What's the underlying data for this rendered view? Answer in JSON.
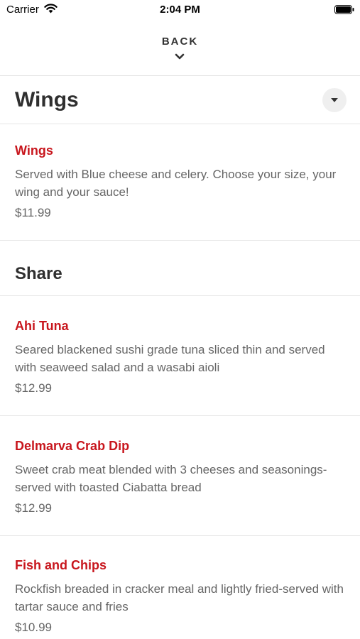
{
  "status_bar": {
    "carrier": "Carrier",
    "time": "2:04 PM"
  },
  "header": {
    "back_label": "BACK"
  },
  "categories": [
    {
      "title": "Wings",
      "items": [
        {
          "name": "Wings",
          "description": "Served with Blue cheese and celery. Choose your size, your wing and your sauce!",
          "price": "$11.99"
        }
      ]
    },
    {
      "title": "Share",
      "items": [
        {
          "name": "Ahi Tuna",
          "description": "Seared blackened sushi grade tuna sliced thin and served with seaweed salad and a wasabi aioli",
          "price": "$12.99"
        },
        {
          "name": "Delmarva Crab Dip",
          "description": "Sweet crab meat blended with 3 cheeses and seasonings-served with toasted Ciabatta bread",
          "price": "$12.99"
        },
        {
          "name": "Fish and Chips",
          "description": "Rockfish breaded in cracker meal and lightly fried-served with tartar sauce and fries",
          "price": "$10.99"
        }
      ]
    }
  ],
  "colors": {
    "item_name": "#c8161d",
    "text_muted": "#666666",
    "divider": "#e6e6e6"
  },
  "icons": {
    "wifi": "wifi-icon",
    "battery": "battery-icon",
    "back_chevron": "chevron-down-icon",
    "dropdown": "caret-down-icon"
  }
}
